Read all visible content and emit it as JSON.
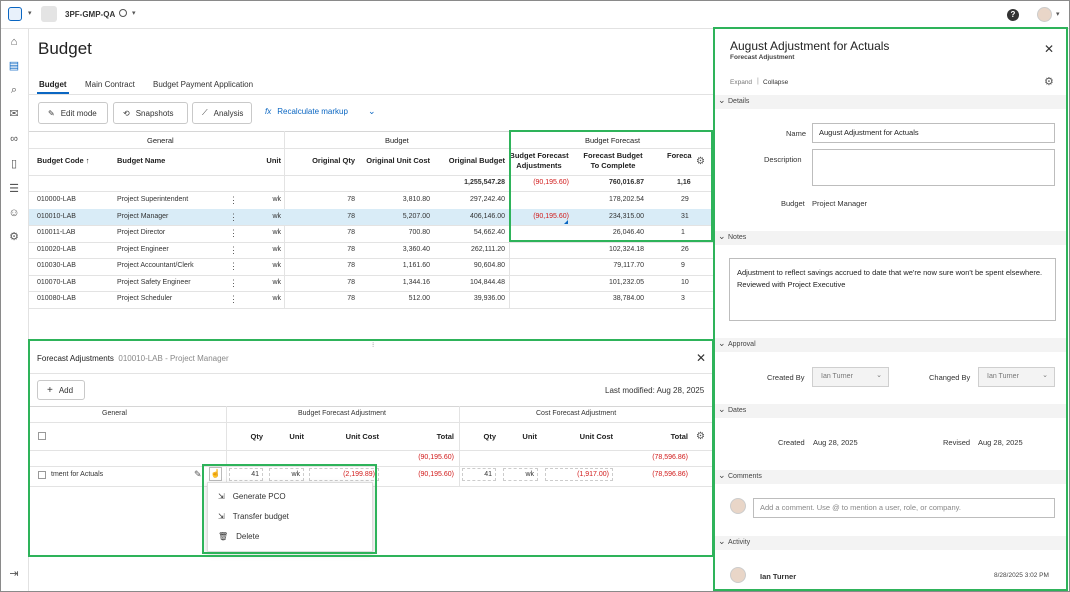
{
  "topbar": {
    "project": "3PF-GMP-QA",
    "help": "?"
  },
  "page": {
    "title": "Budget"
  },
  "tabs": [
    "Budget",
    "Main Contract",
    "Budget Payment Application"
  ],
  "toolbar": {
    "edit_mode": "Edit mode",
    "snapshots": "Snapshots",
    "analysis": "Analysis",
    "recalc": "Recalculate markup"
  },
  "table": {
    "group_general": "General",
    "group_budget": "Budget",
    "group_forecast": "Budget Forecast",
    "columns": {
      "code": "Budget Code",
      "name": "Budget Name",
      "unit": "Unit",
      "orig_qty": "Original Qty",
      "orig_unit_cost": "Original Unit Cost",
      "orig_budget": "Original Budget",
      "bfa_line1": "Budget Forecast",
      "bfa_line2": "Adjustments",
      "fbtc_line1": "Forecast Budget",
      "fbtc_line2": "To Complete",
      "forecast_trunc": "Foreca"
    },
    "totals": {
      "orig_budget": "1,255,547.28",
      "bfa": "(90,195.60)",
      "fbtc": "760,016.87",
      "last": "1,16"
    },
    "rows": [
      {
        "code": "010000-LAB",
        "name": "Project Superintendent",
        "unit": "wk",
        "qty": "78",
        "unit_cost": "3,810.80",
        "budget": "297,242.40",
        "bfa": "",
        "fbtc": "178,202.54",
        "last": "29"
      },
      {
        "code": "010010-LAB",
        "name": "Project Manager",
        "unit": "wk",
        "qty": "78",
        "unit_cost": "5,207.00",
        "budget": "406,146.00",
        "bfa": "(90,195.60)",
        "fbtc": "234,315.00",
        "last": "31"
      },
      {
        "code": "010011-LAB",
        "name": "Project Director",
        "unit": "wk",
        "qty": "78",
        "unit_cost": "700.80",
        "budget": "54,662.40",
        "bfa": "",
        "fbtc": "26,046.40",
        "last": "1"
      },
      {
        "code": "010020-LAB",
        "name": "Project Engineer",
        "unit": "wk",
        "qty": "78",
        "unit_cost": "3,360.40",
        "budget": "262,111.20",
        "bfa": "",
        "fbtc": "102,324.18",
        "last": "26"
      },
      {
        "code": "010030-LAB",
        "name": "Project Accountant/Clerk",
        "unit": "wk",
        "qty": "78",
        "unit_cost": "1,161.60",
        "budget": "90,604.80",
        "bfa": "",
        "fbtc": "79,117.70",
        "last": "9"
      },
      {
        "code": "010070-LAB",
        "name": "Project Safety Engineer",
        "unit": "wk",
        "qty": "78",
        "unit_cost": "1,344.16",
        "budget": "104,844.48",
        "bfa": "",
        "fbtc": "101,232.05",
        "last": "10"
      },
      {
        "code": "010080-LAB",
        "name": "Project Scheduler",
        "unit": "wk",
        "qty": "78",
        "unit_cost": "512.00",
        "budget": "39,936.00",
        "bfa": "",
        "fbtc": "38,784.00",
        "last": "3"
      }
    ]
  },
  "forecast_panel": {
    "title": "Forecast Adjustments",
    "subtitle": "010010-LAB - Project Manager",
    "add": "Add",
    "last_modified": "Last modified: Aug 28, 2025",
    "group_general": "General",
    "group_bfa": "Budget Forecast Adjustment",
    "group_cfa": "Cost Forecast Adjustment",
    "cols": {
      "qty": "Qty",
      "unit": "Unit",
      "unit_cost": "Unit Cost",
      "total": "Total"
    },
    "totals": {
      "bfa": "(90,195.60)",
      "cfa": "(78,596.86)"
    },
    "row": {
      "name": "tment for Actuals",
      "qty": "41",
      "unit": "wk",
      "unit_cost": "(2,199.89)",
      "total": "(90,195.60)",
      "c_qty": "41",
      "c_unit": "wk",
      "c_unit_cost": "(1,917.00)",
      "c_total": "(78,596.86)"
    },
    "menu": [
      "Generate PCO",
      "Transfer budget",
      "Delete"
    ]
  },
  "detail": {
    "title": "August Adjustment for Actuals",
    "subtitle": "Forecast Adjustment",
    "expand": "Expand",
    "collapse": "Collapse",
    "sections": {
      "details": "Details",
      "notes": "Notes",
      "approval": "Approval",
      "dates": "Dates",
      "comments": "Comments",
      "activity": "Activity"
    },
    "name_label": "Name",
    "name_value": "August Adjustment for Actuals",
    "desc_label": "Description",
    "budget_label": "Budget",
    "budget_value": "Project Manager",
    "notes": "Adjustment to reflect savings accrued to date that we're now sure won't be spent elsewhere. Reviewed with Project Executive",
    "created_by_label": "Created By",
    "created_by": "Ian Turner",
    "changed_by_label": "Changed By",
    "changed_by": "Ian Turner",
    "created_label": "Created",
    "created": "Aug 28, 2025",
    "revised_label": "Revised",
    "revised": "Aug 28, 2025",
    "comment_placeholder": "Add a comment. Use @ to mention a user, role, or company.",
    "activity_user": "Ian Turner",
    "activity_time": "8/28/2025 3:02 PM"
  },
  "colors": {
    "accent": "#0a66c2",
    "highlight": "#2eb35a",
    "negative": "#d11a1a",
    "selected_row": "#d9ecf7"
  }
}
